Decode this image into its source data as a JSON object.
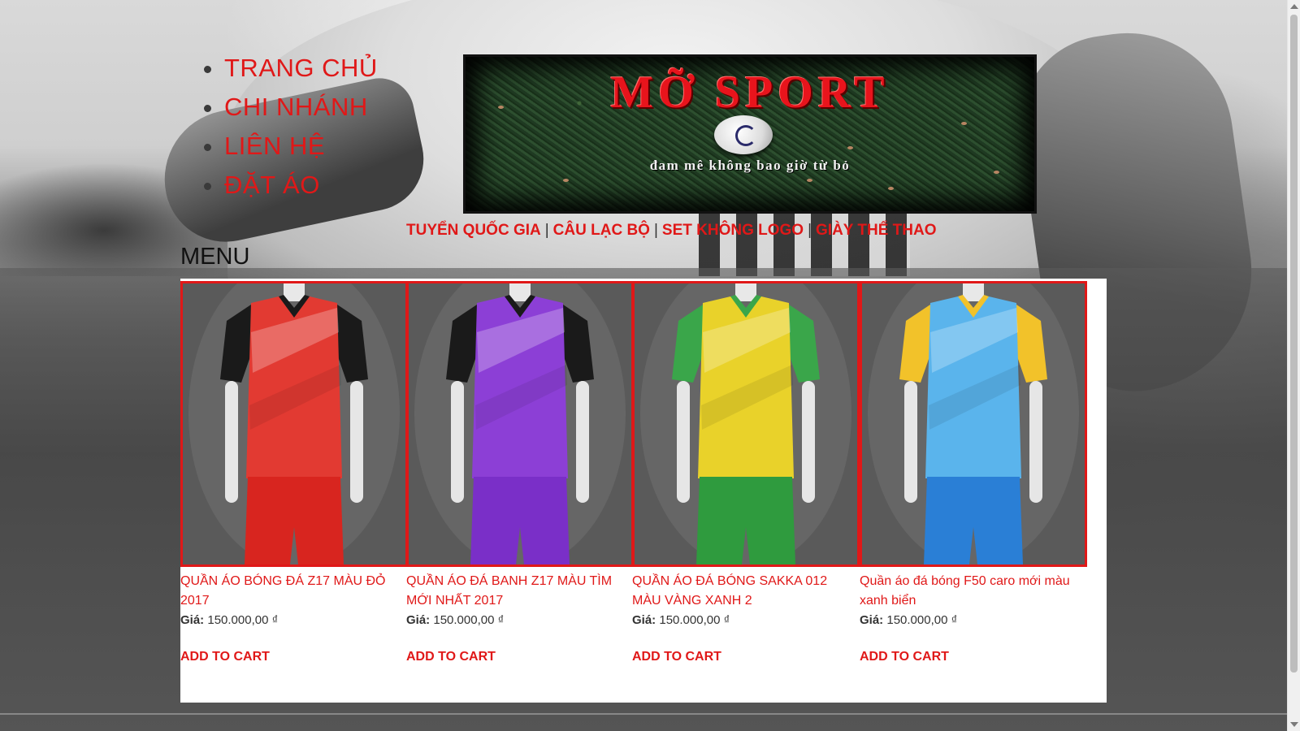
{
  "nav": {
    "items": [
      "TRANG CHỦ",
      "CHI NHÁNH",
      "LIÊN HỆ",
      "ĐẶT ÁO"
    ]
  },
  "banner": {
    "title": "MỠ SPORT",
    "slogan": "đam mê không bao giờ từ bỏ"
  },
  "categories": {
    "items": [
      "TUYỂN QUỐC GIA",
      "CÂU LẠC BỘ",
      "SET KHÔNG LOGO",
      "GIÀY THỂ THAO"
    ],
    "separator": "|"
  },
  "menu": {
    "heading": "MENU"
  },
  "products": [
    {
      "name": "QUẦN ÁO BÓNG ĐÁ Z17 MÀU ĐỎ 2017",
      "price_label": "Giá:",
      "price": "150.000,00 ₫",
      "cart_label": "ADD TO CART",
      "shirt_color": "#e23a32",
      "short_color": "#d8251f",
      "accent_color": "#1a1a1a"
    },
    {
      "name": "QUẦN ÁO ĐÁ BANH Z17 MÀU TÌM MỚI NHẤT 2017",
      "price_label": "Giá:",
      "price": "150.000,00 ₫",
      "cart_label": "ADD TO CART",
      "shirt_color": "#8c3fd6",
      "short_color": "#7a2fc8",
      "accent_color": "#1a1a1a"
    },
    {
      "name": "QUẦN ÁO ĐÁ BÓNG SAKKA 012 MÀU VÀNG XANH 2",
      "price_label": "Giá:",
      "price": "150.000,00 ₫",
      "cart_label": "ADD TO CART",
      "shirt_color": "#e9d22a",
      "short_color": "#2f9b3e",
      "accent_color": "#3aa64a"
    },
    {
      "name": "Quần áo đá bóng F50 caro mới màu xanh biển",
      "price_label": "Giá:",
      "price": "150.000,00 ₫",
      "cart_label": "ADD TO CART",
      "shirt_color": "#5ab4ec",
      "short_color": "#2a7fd6",
      "accent_color": "#f2c22a"
    }
  ],
  "colors": {
    "accent_red": "#e01818",
    "panel_bg": "#ffffff"
  }
}
